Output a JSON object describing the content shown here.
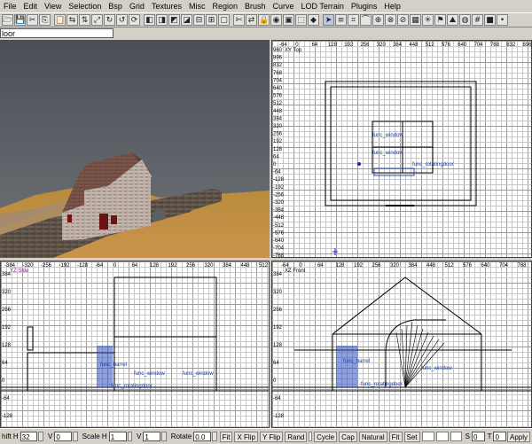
{
  "menu": [
    "File",
    "Edit",
    "View",
    "Selection",
    "Bsp",
    "Grid",
    "Textures",
    "Misc",
    "Region",
    "Brush",
    "Curve",
    "LOD Terrain",
    "Plugins",
    "Help"
  ],
  "toolbar": {
    "icons": [
      "open-icon",
      "save-icon",
      "cut-icon",
      "copy-icon",
      "paste-icon",
      "flip-x-icon",
      "flip-y-icon",
      "flip-z-icon",
      "rotate-x-icon",
      "rotate-y-icon",
      "rotate-z-icon",
      "select-complete-icon",
      "select-touching-icon",
      "select-partial-icon",
      "select-inside-icon",
      "csg-subtract-icon",
      "csg-merge-icon",
      "hollow-icon",
      "clipper-icon",
      "change-view-icon",
      "texture-lock-icon",
      "camera-view-icon",
      "cubic-clip-icon",
      "drag-edge-icon",
      "drag-vertex-icon",
      "select-cursor-icon",
      "show-entities-icon",
      "patch-icon",
      "patch-bend-icon",
      "patch-insert-icon",
      "patch-weld-icon",
      "patch-drill-icon",
      "texture-view-icon",
      "light-icon",
      "entity-icon",
      "terrain-icon",
      "models-icon",
      "grid-icon",
      "brush-icon",
      "point-icon"
    ],
    "glyphs": [
      "🗁",
      "💾",
      "✂",
      "⎘",
      "📋",
      "⇆",
      "⇅",
      "⤢",
      "↻",
      "↺",
      "⟳",
      "◧",
      "◨",
      "◩",
      "◪",
      "⊟",
      "⊞",
      "▢",
      "✄",
      "⇄",
      "🔒",
      "◉",
      "▣",
      "⬚",
      "◆",
      "➤",
      "≡",
      "⌗",
      "⌒",
      "⊕",
      "⊗",
      "⊘",
      "▦",
      "✳",
      "⚑",
      "⛰",
      "◍",
      "#",
      "■",
      "•"
    ],
    "selected_index": 25
  },
  "texture_field": {
    "value": "loor"
  },
  "xy_view": {
    "title": "XY Top",
    "v_ticks": [
      "960",
      "896",
      "832",
      "768",
      "704",
      "640",
      "576",
      "512",
      "448",
      "384",
      "320",
      "256",
      "192",
      "128",
      "64",
      "0",
      "-64",
      "-128",
      "-192",
      "-256",
      "-320",
      "-384",
      "-448",
      "-512",
      "-576",
      "-640",
      "-704",
      "-768"
    ],
    "h_ticks": [
      "-64",
      "0",
      "64",
      "128",
      "192",
      "256",
      "320",
      "384",
      "448",
      "512",
      "576",
      "640",
      "704",
      "768",
      "832",
      "896"
    ],
    "labels": [
      "func_window",
      "func_window",
      "func_rotatingdoor"
    ]
  },
  "yz_view": {
    "title": "YZ Side",
    "h_ticks": [
      "-384",
      "-320",
      "-256",
      "-192",
      "-128",
      "-64",
      "0",
      "64",
      "128",
      "192",
      "256",
      "320",
      "384",
      "448",
      "512"
    ],
    "v_ticks": [
      "384",
      "320",
      "256",
      "192",
      "128",
      "64",
      "0",
      "-64",
      "-128"
    ],
    "labels": [
      "func_barrel",
      "func_window",
      "func_window",
      "func_rotatingdoor"
    ]
  },
  "xz_view": {
    "title": "XZ Front",
    "h_ticks": [
      "-64",
      "0",
      "64",
      "128",
      "192",
      "256",
      "320",
      "384",
      "448",
      "512",
      "576",
      "640",
      "704",
      "768"
    ],
    "v_ticks": [
      "384",
      "320",
      "256",
      "192",
      "128",
      "64",
      "0",
      "-64",
      "-128"
    ],
    "labels": [
      "func_barrel",
      "func_window",
      "func_rotatingdoor"
    ]
  },
  "statusbar": {
    "shift_h_label": "hift H",
    "shift_h": "32",
    "v_label": "V",
    "shift_v": "0",
    "scale_label": "Scale H",
    "scale_h": "1",
    "scale_v_label": "V",
    "scale_v": "1",
    "rotate_label": "Rotate",
    "rotate": "0.0",
    "fit_label": "Fit",
    "xflip_label": "X Flip",
    "yflip_label": "Y Flip",
    "rand_label": "Rand",
    "cycle_label": "Cycle",
    "cap_label": "Cap",
    "natural_label": "Natural",
    "fit2_label": "Fit",
    "set_label": "Set",
    "s_label": "S",
    "s_value": "0",
    "t_label": "T",
    "t_value": "0",
    "apply_label": "Apply"
  }
}
